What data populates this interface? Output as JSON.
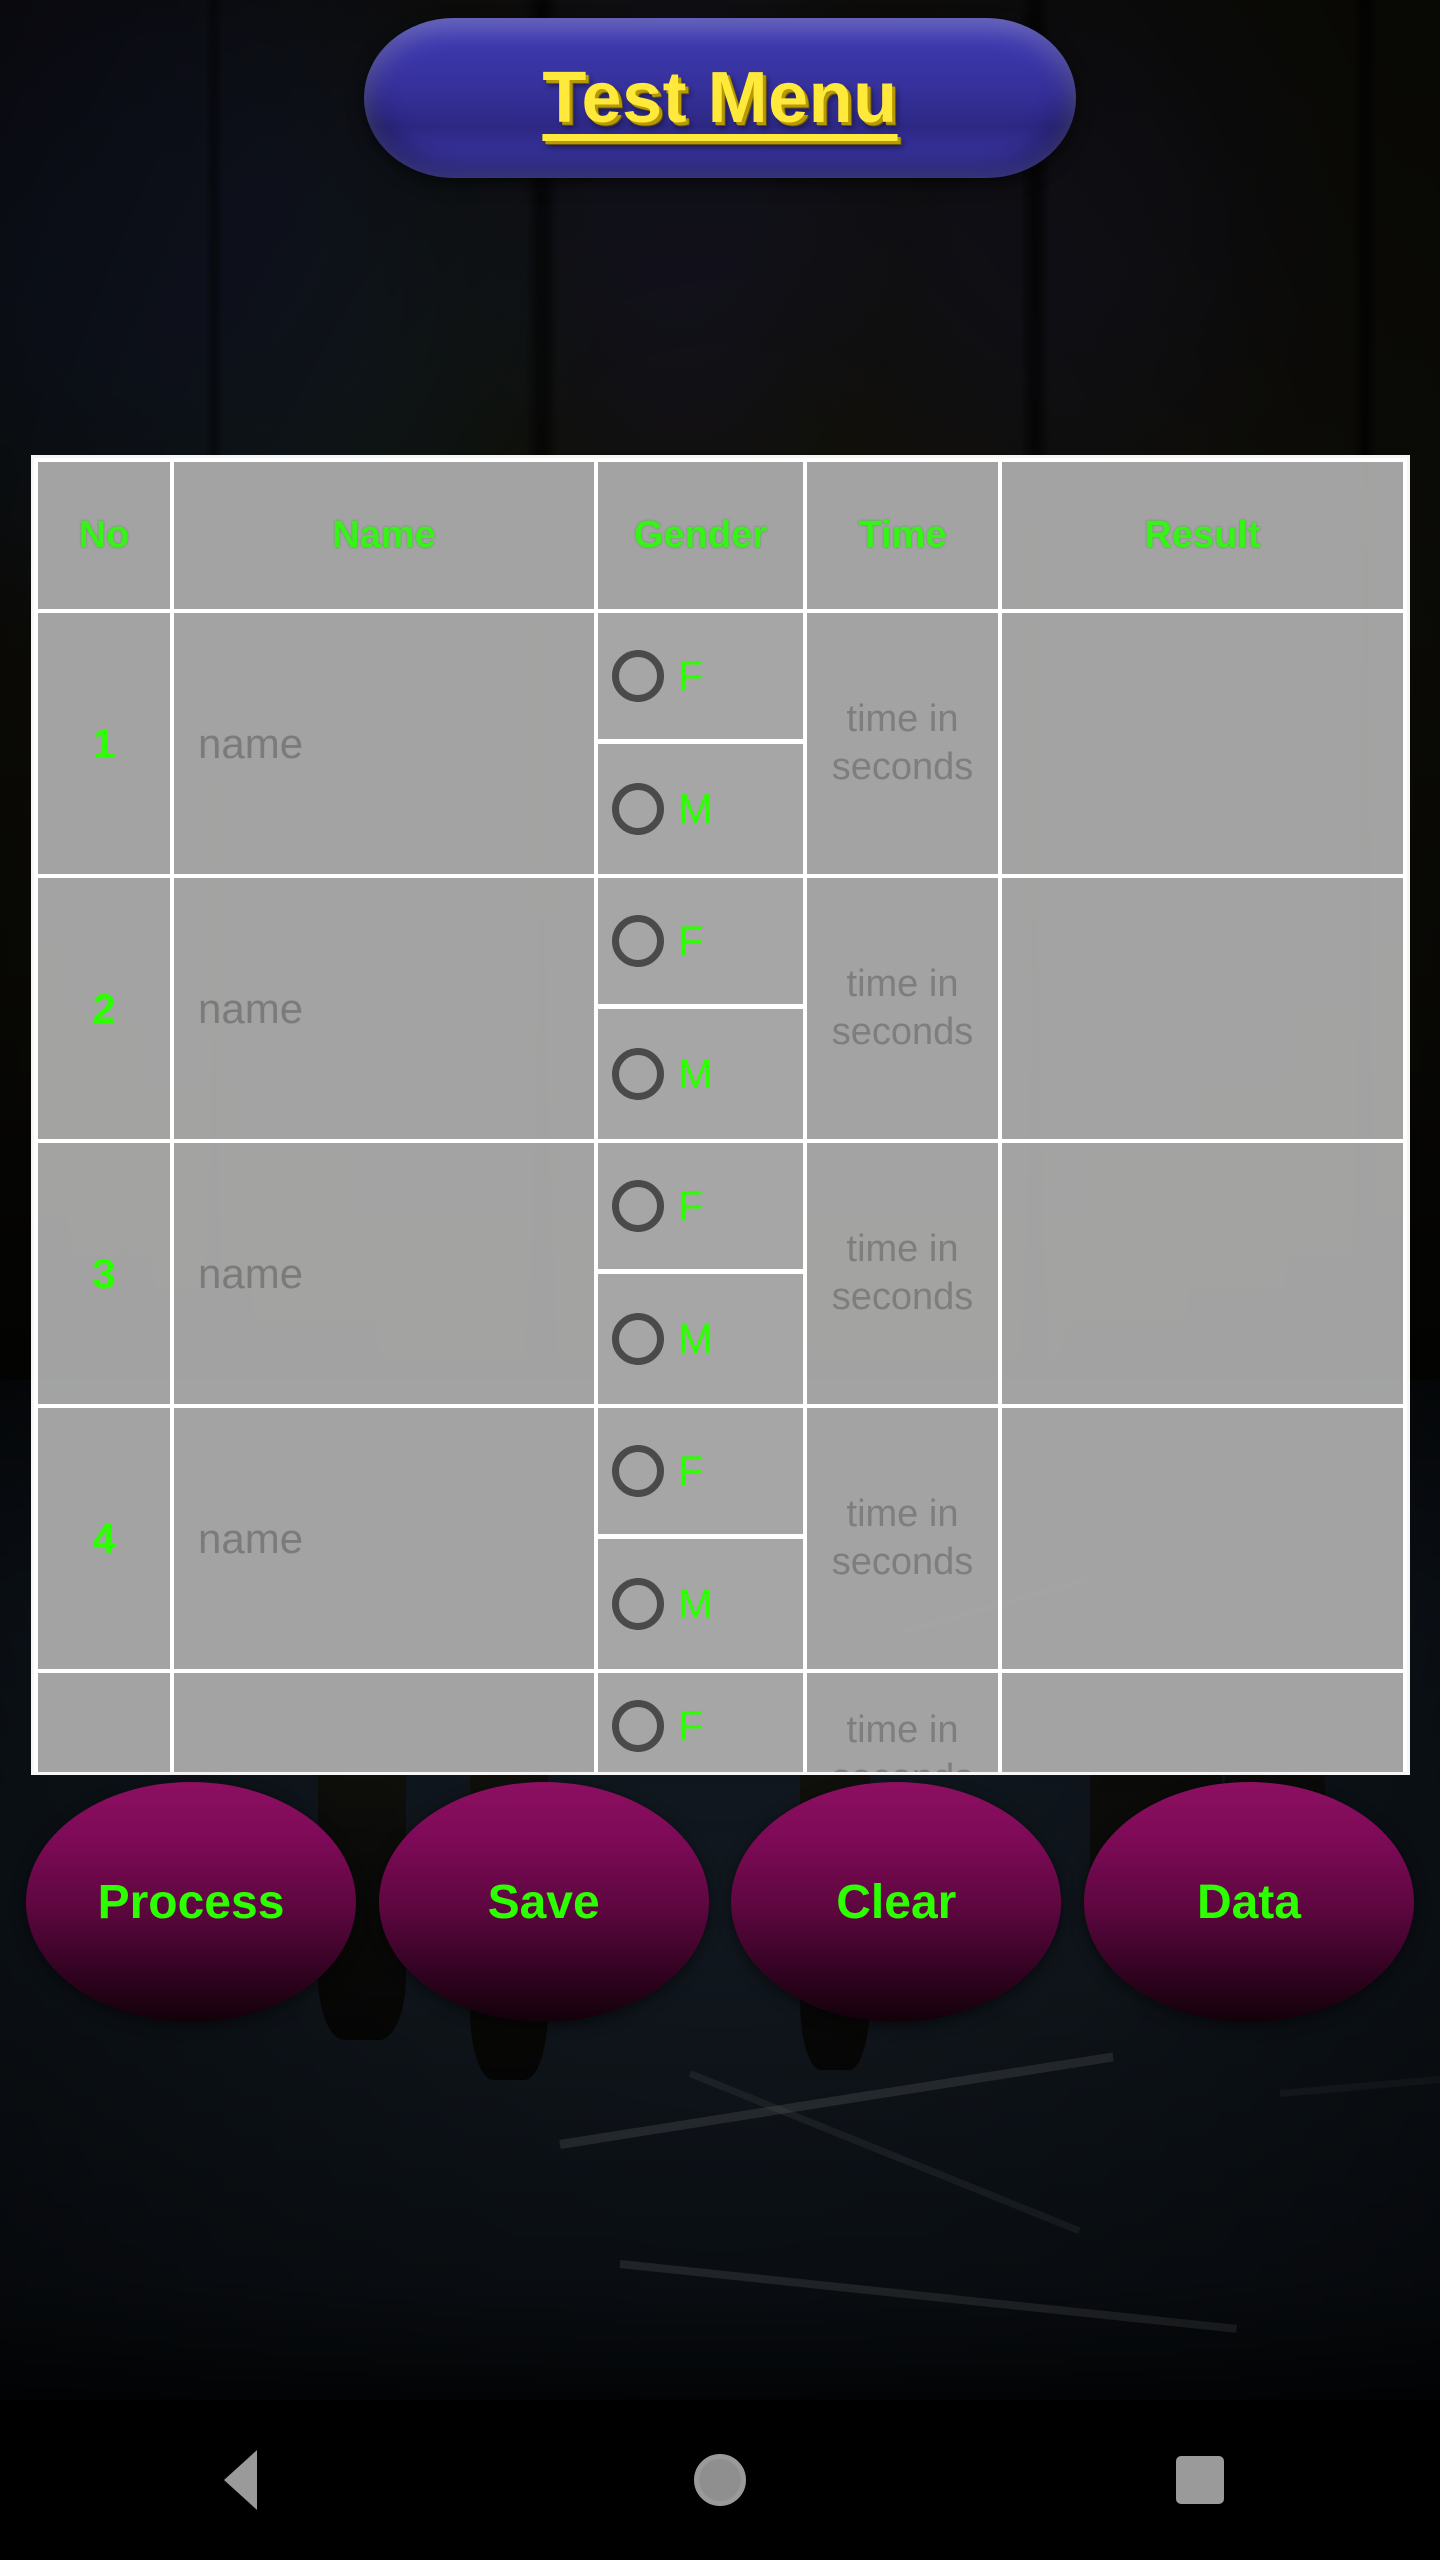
{
  "app": {
    "title": "Test Menu"
  },
  "table": {
    "headers": [
      "No",
      "Name",
      "Gender",
      "Time",
      "Result"
    ],
    "name_placeholder": "name",
    "time_placeholder": "time in seconds",
    "gender_options": [
      "F",
      "M"
    ],
    "rows": [
      {
        "no": "1",
        "name": "",
        "gender": "",
        "time": "",
        "result": ""
      },
      {
        "no": "2",
        "name": "",
        "gender": "",
        "time": "",
        "result": ""
      },
      {
        "no": "3",
        "name": "",
        "gender": "",
        "time": "",
        "result": ""
      },
      {
        "no": "4",
        "name": "",
        "gender": "",
        "time": "",
        "result": ""
      },
      {
        "no": "",
        "name": "",
        "gender": "",
        "time": "",
        "result": ""
      }
    ]
  },
  "actions": [
    {
      "label": "Process"
    },
    {
      "label": "Save"
    },
    {
      "label": "Clear"
    },
    {
      "label": "Data"
    }
  ],
  "navbar": {
    "back": "back-icon",
    "home": "home-icon",
    "recents": "recents-icon"
  },
  "colors": {
    "accent_green": "#2bff00",
    "header_green": "#38f318",
    "title_yellow": "#FFE93B",
    "title_pill_blue": "#353099",
    "button_magenta": "#8d0f61",
    "cell_gray": "#aaaaaa",
    "placeholder_gray": "#7b7b7b"
  }
}
